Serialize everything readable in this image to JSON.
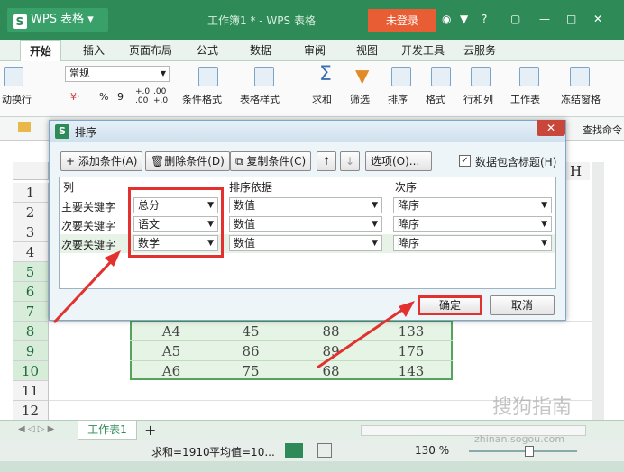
{
  "app": {
    "brand": "WPS 表格",
    "document_title": "工作簿1 * - WPS 表格",
    "login_label": "未登录",
    "help_label": "?"
  },
  "menu": {
    "tabs": [
      "开始",
      "插入",
      "页面布局",
      "公式",
      "数据",
      "审阅",
      "视图",
      "开发工具",
      "云服务"
    ]
  },
  "ribbon": {
    "wrap_label": "动换行",
    "number_format": "常规",
    "percent": "%",
    "thousands": "9",
    "dec_inc": "+.0\n.00",
    "dec_dec": ".00\n+.0",
    "cond_format": "条件格式",
    "table_style": "表格样式",
    "sum": "求和",
    "filter": "筛选",
    "sort": "排序",
    "format": "格式",
    "rowcol": "行和列",
    "worksheet": "工作表",
    "freeze": "冻结窗格",
    "find": "查找命令"
  },
  "sheet": {
    "rows": [
      "1",
      "2",
      "3",
      "4",
      "5",
      "6",
      "7",
      "8",
      "9",
      "10",
      "11",
      "12"
    ],
    "col_h": "H",
    "data_rows": [
      {
        "a": "A4",
        "b": "45",
        "c": "88",
        "d": "133"
      },
      {
        "a": "A5",
        "b": "86",
        "c": "89",
        "d": "175"
      },
      {
        "a": "A6",
        "b": "75",
        "c": "68",
        "d": "143"
      }
    ]
  },
  "dialog": {
    "title": "排序",
    "add_condition": "添加条件(A)",
    "delete_condition": "删除条件(D)",
    "copy_condition": "复制条件(C)",
    "options": "选项(O)...",
    "header_checkbox_label": "数据包含标题(H)",
    "header_checkbox_checked": true,
    "col_headers": {
      "column": "列",
      "sort_on": "排序依据",
      "order": "次序"
    },
    "conditions": [
      {
        "label": "主要关键字",
        "column": "总分",
        "sort_on": "数值",
        "order": "降序"
      },
      {
        "label": "次要关键字",
        "column": "语文",
        "sort_on": "数值",
        "order": "降序"
      },
      {
        "label": "次要关键字",
        "column": "数学",
        "sort_on": "数值",
        "order": "降序"
      }
    ],
    "ok": "确定",
    "cancel": "取消"
  },
  "sheettabs": {
    "tab": "工作表1",
    "add": "+"
  },
  "status": {
    "sum": "求和=1910",
    "avg": "平均值=10...",
    "zoom": "130 %"
  },
  "watermark": {
    "text": "搜狗指南",
    "url": "zhinan.sogou.com"
  },
  "colors": {
    "accent": "#2e8b57",
    "highlight": "#e2312f",
    "login": "#e85d33"
  }
}
